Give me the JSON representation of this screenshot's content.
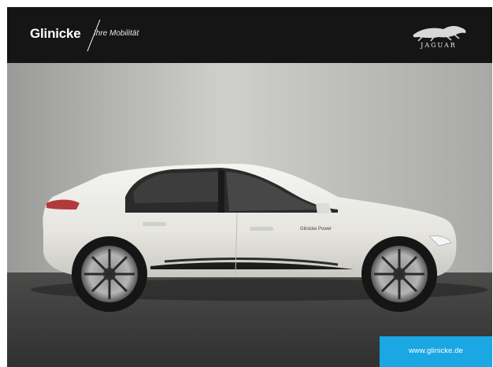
{
  "header": {
    "brand_name": "Glinicke",
    "tagline": "Ihre Mobilität",
    "logo_word": "JAGUAR",
    "logo_icon": "jaguar-leaper-icon"
  },
  "photo": {
    "door_decal": "Glinicke Power"
  },
  "cta": {
    "url_text": "www.glinicke.de",
    "color": "#1aa7e3"
  },
  "colors": {
    "header_bg": "#151515",
    "car_body": "#e9e8e3"
  }
}
